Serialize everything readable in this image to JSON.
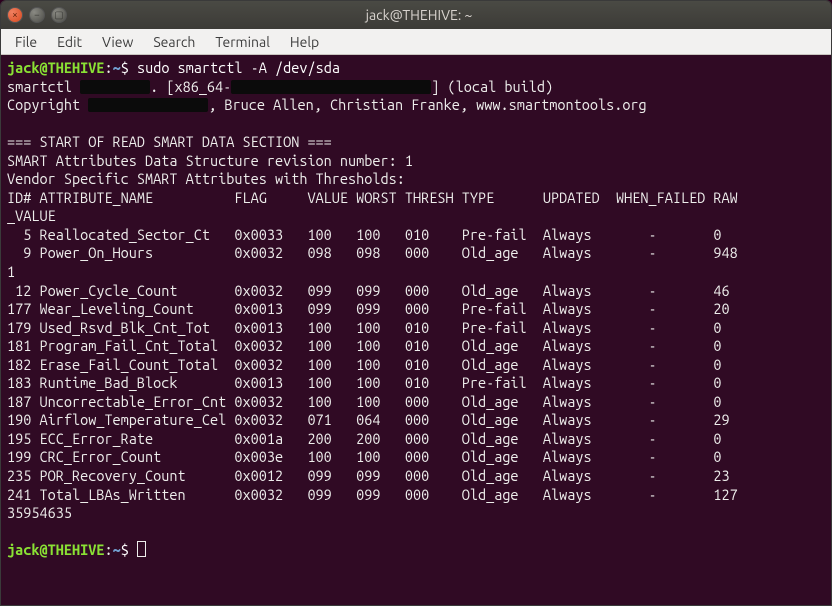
{
  "title": "jack@THEHIVE: ~",
  "menus": [
    "File",
    "Edit",
    "View",
    "Search",
    "Terminal",
    "Help"
  ],
  "prompt": {
    "userhost": "jack@THEHIVE",
    "sep": ":",
    "path": "~",
    "dollar": "$ "
  },
  "command": "sudo smartctl -A /dev/sda",
  "line_smartctl": {
    "a": "smartctl ",
    "b": ". [x86_64-",
    "c": "] (local build)"
  },
  "line_copyright": {
    "a": "Copyright ",
    "b": ", Bruce Allen, Christian Franke, www.smartmontools.org"
  },
  "blank": "",
  "sec1": "=== START OF READ SMART DATA SECTION ===",
  "sec2": "SMART Attributes Data Structure revision number: 1",
  "sec3": "Vendor Specific SMART Attributes with Thresholds:",
  "hdr1": "ID# ATTRIBUTE_NAME          FLAG     VALUE WORST THRESH TYPE      UPDATED  WHEN_FAILED RAW",
  "hdr2": "_VALUE",
  "rows": [
    "  5 Reallocated_Sector_Ct   0x0033   100   100   010    Pre-fail  Always       -       0",
    "  9 Power_On_Hours          0x0032   098   098   000    Old_age   Always       -       948"
  ],
  "wrap1": "1",
  "rows2": [
    " 12 Power_Cycle_Count       0x0032   099   099   000    Old_age   Always       -       46",
    "177 Wear_Leveling_Count     0x0013   099   099   000    Pre-fail  Always       -       20",
    "179 Used_Rsvd_Blk_Cnt_Tot   0x0013   100   100   010    Pre-fail  Always       -       0",
    "181 Program_Fail_Cnt_Total  0x0032   100   100   010    Old_age   Always       -       0",
    "182 Erase_Fail_Count_Total  0x0032   100   100   010    Old_age   Always       -       0",
    "183 Runtime_Bad_Block       0x0013   100   100   010    Pre-fail  Always       -       0",
    "187 Uncorrectable_Error_Cnt 0x0032   100   100   000    Old_age   Always       -       0",
    "190 Airflow_Temperature_Cel 0x0032   071   064   000    Old_age   Always       -       29",
    "195 ECC_Error_Rate          0x001a   200   200   000    Old_age   Always       -       0",
    "199 CRC_Error_Count         0x003e   100   100   000    Old_age   Always       -       0",
    "235 POR_Recovery_Count      0x0012   099   099   000    Old_age   Always       -       23",
    "241 Total_LBAs_Written      0x0032   099   099   000    Old_age   Always       -       127"
  ],
  "wrap2": "35954635"
}
